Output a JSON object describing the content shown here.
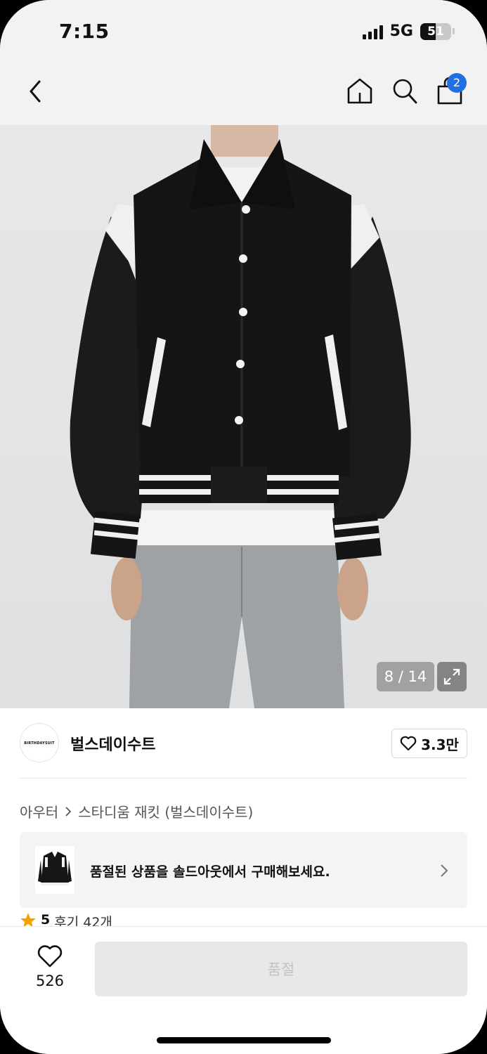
{
  "status_bar": {
    "time": "7:15",
    "network": "5G",
    "battery": "51",
    "battery_level": 0.51
  },
  "header": {
    "back_icon": "chevron-left-icon",
    "home_icon": "home-icon",
    "search_icon": "search-icon",
    "cart_icon": "shopping-bag-icon",
    "cart_badge": "2",
    "badge_color": "#1f6fe5"
  },
  "gallery": {
    "counter": "8 / 14",
    "expand_icon": "expand-icon"
  },
  "brand": {
    "logo_text": "BIRTHDAYSUIT",
    "name": "벌스데이수트",
    "like_count": "3.3만"
  },
  "breadcrumb": {
    "category": "아우터",
    "product": "스타디움 재킷 (벌스데이수트)"
  },
  "soldout_banner": {
    "text": "품절된 상품을 솔드아웃에서 구매해보세요."
  },
  "review": {
    "score": "5",
    "count_text": "후기 42개",
    "star_color": "#f5a300"
  },
  "bottom_bar": {
    "wish_count": "526",
    "purchase_label": "품절"
  }
}
